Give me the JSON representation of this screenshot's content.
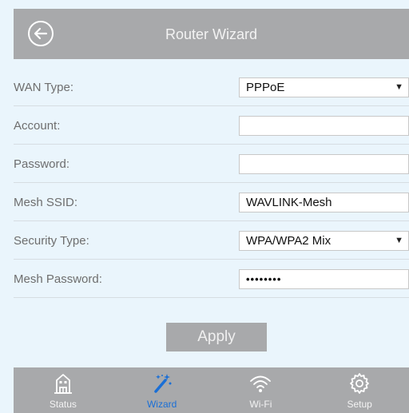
{
  "header": {
    "title": "Router Wizard"
  },
  "form": {
    "wan_type": {
      "label": "WAN Type:",
      "value": "PPPoE"
    },
    "account": {
      "label": "Account:",
      "value": ""
    },
    "password": {
      "label": "Password:",
      "value": ""
    },
    "mesh_ssid": {
      "label": "Mesh SSID:",
      "value": "WAVLINK-Mesh"
    },
    "security_type": {
      "label": "Security Type:",
      "value": "WPA/WPA2 Mix"
    },
    "mesh_password": {
      "label": "Mesh Password:",
      "value": "••••••••"
    }
  },
  "apply_label": "Apply",
  "nav": [
    {
      "label": "Status",
      "icon": "building-icon"
    },
    {
      "label": "Wizard",
      "icon": "magic-wand-icon",
      "active": true
    },
    {
      "label": "Wi-Fi",
      "icon": "wifi-icon"
    },
    {
      "label": "Setup",
      "icon": "gear-icon"
    }
  ],
  "colors": {
    "background": "#eaf5fc",
    "bar": "#a8a9ab",
    "active": "#1a6fd6"
  }
}
